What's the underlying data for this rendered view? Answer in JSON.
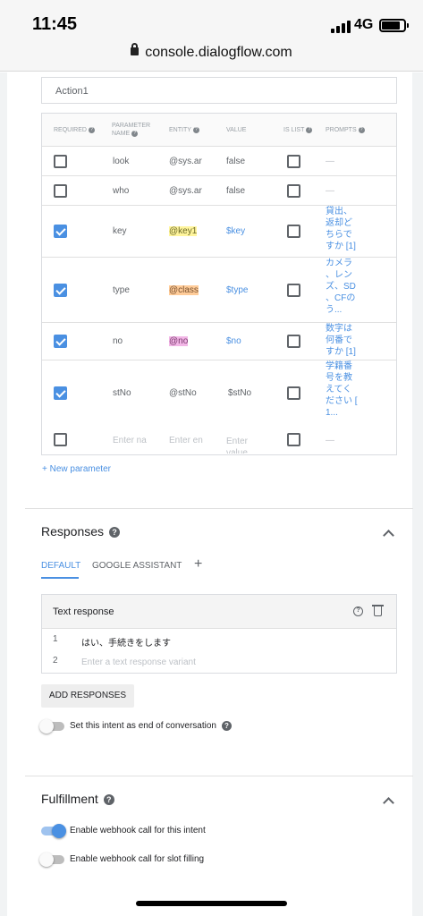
{
  "status_bar": {
    "time": "11:45",
    "network": "4G"
  },
  "browser": {
    "url": "console.dialogflow.com"
  },
  "action": {
    "value": "Action1"
  },
  "parameters": {
    "headers": {
      "required": "REQUIRED",
      "parameter_name_1": "PARAMETER",
      "parameter_name_2": "NAME",
      "entity": "ENTITY",
      "value": "VALUE",
      "is_list": "IS LIST",
      "prompts": "PROMPTS"
    },
    "rows": [
      {
        "required": false,
        "name": "look",
        "entity": "@sys.ar",
        "value": "false",
        "is_list": false,
        "prompt_lines": [
          "—"
        ]
      },
      {
        "required": false,
        "name": "who",
        "entity": "@sys.ar",
        "value": "false",
        "is_list": false,
        "prompt_lines": [
          "—"
        ]
      },
      {
        "required": true,
        "name": "key",
        "entity": "@key1",
        "value": "$key",
        "is_list": false,
        "prompt_lines": [
          "貸出、",
          "返却ど",
          "ちらで",
          "すか [1]"
        ]
      },
      {
        "required": true,
        "name": "type",
        "entity": "@class",
        "value": "$type",
        "is_list": false,
        "prompt_lines": [
          "カメラ",
          "、レン",
          "ズ、SD",
          "、CFの",
          "う..."
        ]
      },
      {
        "required": true,
        "name": "no",
        "entity": "@no",
        "value": "$no",
        "is_list": false,
        "prompt_lines": [
          "数字は",
          "何番で",
          "すか [1]"
        ]
      },
      {
        "required": true,
        "name": "stNo",
        "entity": "@stNo",
        "value": "$stNo",
        "is_list": false,
        "prompt_lines": [
          "学籍番",
          "号を教",
          "えてく",
          "ださい [",
          "1..."
        ]
      }
    ],
    "empty_row": {
      "name_placeholder": "Enter na",
      "entity_placeholder": "Enter en",
      "value_placeholder_1": "Enter",
      "value_placeholder_2": "value",
      "prompt": "—"
    },
    "new_parameter_label": "+ New parameter"
  },
  "responses": {
    "title": "Responses",
    "tabs": [
      "DEFAULT",
      "GOOGLE ASSISTANT"
    ],
    "add_tab": "+",
    "card_title": "Text response",
    "items": [
      {
        "num": "1",
        "text": "はい、手続きをします"
      },
      {
        "num": "2",
        "placeholder": "Enter a text response variant"
      }
    ],
    "add_button": "ADD RESPONSES",
    "end_conversation_label": "Set this intent as end of conversation",
    "end_conversation_on": false
  },
  "fulfillment": {
    "title": "Fulfillment",
    "webhook_label": "Enable webhook call for this intent",
    "webhook_on": true,
    "slot_filling_label": "Enable webhook call for slot filling",
    "slot_filling_on": false
  },
  "colors": {
    "accent": "#4a90e2",
    "highlight_key": "#fff59d",
    "highlight_class": "#ffcc99",
    "highlight_no": "#f2b6e6"
  },
  "icons": {
    "help": "question-circle-icon",
    "delete": "trash-icon",
    "collapse": "chevron-up-icon",
    "lock": "lock-icon"
  }
}
